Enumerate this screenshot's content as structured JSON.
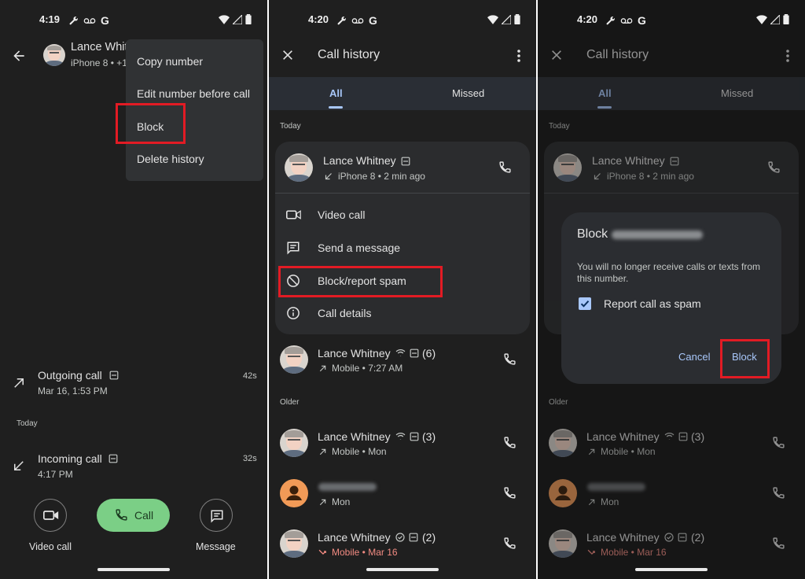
{
  "colors": {
    "background": "#1f1f1f",
    "card": "#2b2c2e",
    "accent_blue": "#a8c7fa",
    "call_green": "#7bcf86",
    "missed_red": "#f28b82",
    "highlight_red": "#e21b24"
  },
  "panel1": {
    "status_time": "4:19",
    "contact_name": "Lance Whit",
    "contact_sub": "iPhone 8 • +1",
    "menu": [
      "Copy number",
      "Edit number before call",
      "Block",
      "Delete history"
    ],
    "history": [
      {
        "label": "Outgoing call",
        "time": "Mar 16, 1:53 PM",
        "duration": "42s"
      },
      {
        "label": "Incoming call",
        "time": "4:17 PM",
        "duration": "32s"
      }
    ],
    "today_label": "Today",
    "actions": {
      "video": "Video call",
      "call": "Call",
      "message": "Message"
    }
  },
  "panel2": {
    "status_time": "4:20",
    "title": "Call history",
    "tabs": [
      "All",
      "Missed"
    ],
    "section_today": "Today",
    "section_older": "Older",
    "expanded": {
      "name": "Lance Whitney",
      "sub": "iPhone 8 • 2 min ago",
      "actions": [
        "Video call",
        "Send a message",
        "Block/report spam",
        "Call details"
      ]
    },
    "entries": [
      {
        "name": "Lance Whitney",
        "count": "(6)",
        "sub": "Mobile • 7:27 AM"
      },
      {
        "name": "Lance Whitney",
        "count": "(3)",
        "sub": "Mobile • Mon"
      },
      {
        "name": "",
        "count": "",
        "sub": "Mon"
      },
      {
        "name": "Lance Whitney",
        "count": "(2)",
        "sub": "Mobile • Mar 16"
      }
    ]
  },
  "panel3": {
    "status_time": "4:20",
    "title": "Call history",
    "tabs": [
      "All",
      "Missed"
    ],
    "section_today": "Today",
    "section_older": "Older",
    "expanded": {
      "name": "Lance Whitney",
      "sub": "iPhone 8 • 2 min ago"
    },
    "entries": [
      {
        "name": "Lance Whitney",
        "count": "(3)",
        "sub": "Mobile • Mon"
      },
      {
        "name": "",
        "count": "",
        "sub": "Mon"
      },
      {
        "name": "Lance Whitney",
        "count": "(2)",
        "sub": "Mobile • Mar 16"
      }
    ],
    "dialog": {
      "title": "Block",
      "body": "You will no longer receive calls or texts from this number.",
      "checkbox_label": "Report call as spam",
      "checkbox_checked": true,
      "cancel": "Cancel",
      "confirm": "Block"
    }
  }
}
